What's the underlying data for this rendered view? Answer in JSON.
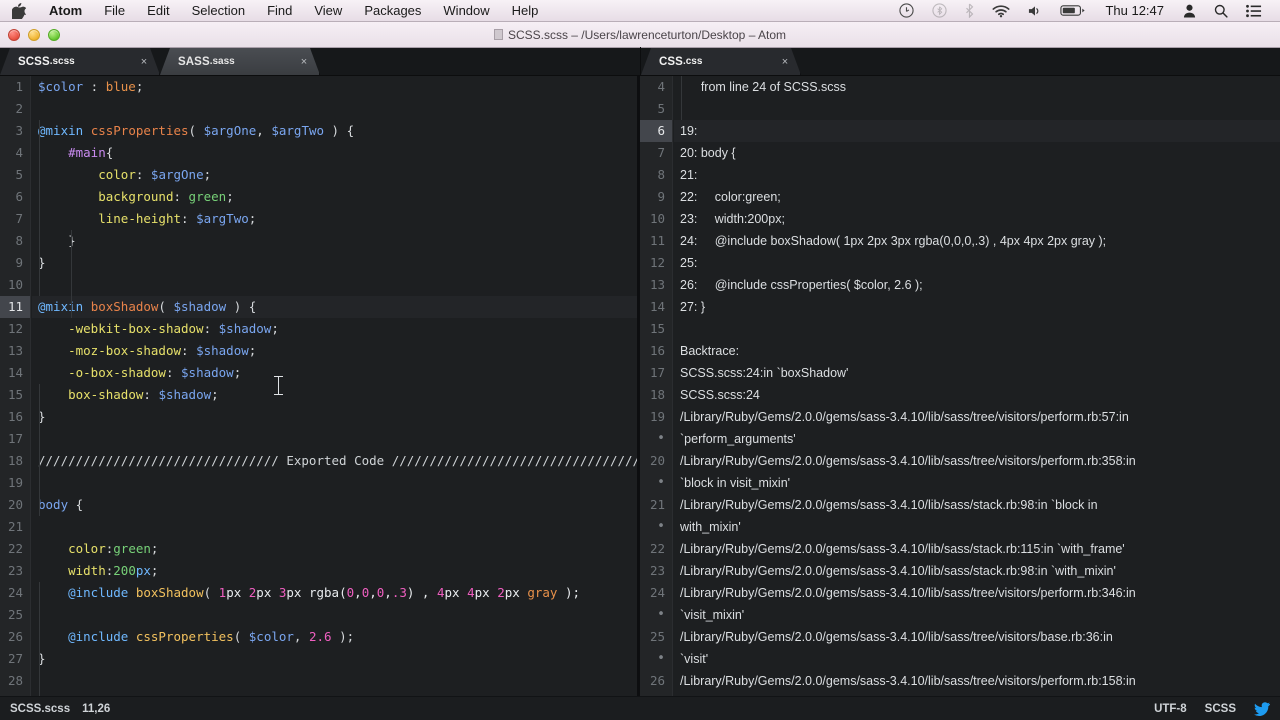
{
  "menubar": {
    "apple_icon": "apple-logo-icon",
    "items": [
      {
        "label": "Atom",
        "bold": true
      },
      {
        "label": "File"
      },
      {
        "label": "Edit"
      },
      {
        "label": "Selection"
      },
      {
        "label": "Find"
      },
      {
        "label": "View"
      },
      {
        "label": "Packages"
      },
      {
        "label": "Window"
      },
      {
        "label": "Help"
      }
    ],
    "status_icons": [
      "airplay-icon",
      "bluetooth-icon",
      "wifi-icon",
      "volume-icon",
      "battery-icon"
    ],
    "clock": "Thu 12:47",
    "right_icons": [
      "user-icon",
      "search-icon",
      "notification-center-icon"
    ]
  },
  "titlebar": {
    "title": "SCSS.scss – /Users/lawrenceturton/Desktop – Atom",
    "traffic_lights": [
      "close",
      "minimize",
      "zoom"
    ]
  },
  "tabs": {
    "left_group": [
      {
        "name": "SCSS",
        "ext": ".scss",
        "active": true,
        "close": "×"
      },
      {
        "name": "SASS",
        "ext": ".sass",
        "active": false,
        "close": "×"
      }
    ],
    "right_group": [
      {
        "name": "CSS",
        "ext": ".css",
        "active": true,
        "close": "×"
      }
    ]
  },
  "left_editor": {
    "file": "SCSS.scss",
    "active_line": 11,
    "first_line": 1,
    "last_visible_line": 28,
    "lines": [
      {
        "n": 1,
        "tokens": [
          {
            "t": "$color",
            "c": "v"
          },
          {
            "t": " : ",
            "c": "pun"
          },
          {
            "t": "blue",
            "c": "orn"
          },
          {
            "t": ";",
            "c": "pun"
          }
        ]
      },
      {
        "n": 2,
        "tokens": []
      },
      {
        "n": 3,
        "tokens": [
          {
            "t": "@mixin",
            "c": "kw"
          },
          {
            "t": " ",
            "c": "pun"
          },
          {
            "t": "cssProperties",
            "c": "fn2"
          },
          {
            "t": "( ",
            "c": "pun"
          },
          {
            "t": "$argOne",
            "c": "v"
          },
          {
            "t": ", ",
            "c": "pun"
          },
          {
            "t": "$argTwo",
            "c": "v"
          },
          {
            "t": " ) {",
            "c": "pun"
          }
        ]
      },
      {
        "n": 4,
        "tokens": [
          {
            "t": "    ",
            "c": "pun"
          },
          {
            "t": "#main",
            "c": "sel"
          },
          {
            "t": "{",
            "c": "pun"
          }
        ]
      },
      {
        "n": 5,
        "tokens": [
          {
            "t": "        ",
            "c": "pun"
          },
          {
            "t": "color",
            "c": "prop"
          },
          {
            "t": ": ",
            "c": "pun"
          },
          {
            "t": "$argOne",
            "c": "v"
          },
          {
            "t": ";",
            "c": "pun"
          }
        ]
      },
      {
        "n": 6,
        "tokens": [
          {
            "t": "        ",
            "c": "pun"
          },
          {
            "t": "background",
            "c": "prop"
          },
          {
            "t": ": ",
            "c": "pun"
          },
          {
            "t": "green",
            "c": "val"
          },
          {
            "t": ";",
            "c": "pun"
          }
        ]
      },
      {
        "n": 7,
        "tokens": [
          {
            "t": "        ",
            "c": "pun"
          },
          {
            "t": "line-height",
            "c": "prop"
          },
          {
            "t": ": ",
            "c": "pun"
          },
          {
            "t": "$argTwo",
            "c": "v"
          },
          {
            "t": ";",
            "c": "pun"
          }
        ]
      },
      {
        "n": 8,
        "tokens": [
          {
            "t": "    }",
            "c": "pun"
          }
        ]
      },
      {
        "n": 9,
        "tokens": [
          {
            "t": "}",
            "c": "pun"
          }
        ]
      },
      {
        "n": 10,
        "tokens": []
      },
      {
        "n": 11,
        "tokens": [
          {
            "t": "@mixin",
            "c": "kw"
          },
          {
            "t": " ",
            "c": "pun"
          },
          {
            "t": "boxShadow",
            "c": "fn2"
          },
          {
            "t": "( ",
            "c": "pun"
          },
          {
            "t": "$shadow",
            "c": "v"
          },
          {
            "t": " ) {",
            "c": "pun"
          }
        ]
      },
      {
        "n": 12,
        "tokens": [
          {
            "t": "    ",
            "c": "pun"
          },
          {
            "t": "-webkit-box-shadow",
            "c": "prop"
          },
          {
            "t": ": ",
            "c": "pun"
          },
          {
            "t": "$shadow",
            "c": "v"
          },
          {
            "t": ";",
            "c": "pun"
          }
        ]
      },
      {
        "n": 13,
        "tokens": [
          {
            "t": "    ",
            "c": "pun"
          },
          {
            "t": "-moz-box-shadow",
            "c": "prop"
          },
          {
            "t": ": ",
            "c": "pun"
          },
          {
            "t": "$shadow",
            "c": "v"
          },
          {
            "t": ";",
            "c": "pun"
          }
        ]
      },
      {
        "n": 14,
        "tokens": [
          {
            "t": "    ",
            "c": "pun"
          },
          {
            "t": "-o-box-shadow",
            "c": "prop"
          },
          {
            "t": ": ",
            "c": "pun"
          },
          {
            "t": "$shadow",
            "c": "v"
          },
          {
            "t": ";",
            "c": "pun"
          }
        ]
      },
      {
        "n": 15,
        "tokens": [
          {
            "t": "    ",
            "c": "pun"
          },
          {
            "t": "box-shadow",
            "c": "prop"
          },
          {
            "t": ": ",
            "c": "pun"
          },
          {
            "t": "$shadow",
            "c": "v"
          },
          {
            "t": ";",
            "c": "pun"
          }
        ]
      },
      {
        "n": 16,
        "tokens": [
          {
            "t": "}",
            "c": "pun"
          }
        ]
      },
      {
        "n": 17,
        "tokens": []
      },
      {
        "n": 18,
        "tokens": [
          {
            "t": "//////////////////////////////// Exported Code //////////////////////////////////////////.",
            "c": "cmt"
          }
        ]
      },
      {
        "n": 19,
        "tokens": []
      },
      {
        "n": 20,
        "tokens": [
          {
            "t": "body",
            "c": "v"
          },
          {
            "t": " {",
            "c": "pun"
          }
        ]
      },
      {
        "n": 21,
        "tokens": []
      },
      {
        "n": 22,
        "tokens": [
          {
            "t": "    ",
            "c": "pun"
          },
          {
            "t": "color",
            "c": "prop"
          },
          {
            "t": ":",
            "c": "pun"
          },
          {
            "t": "green",
            "c": "val"
          },
          {
            "t": ";",
            "c": "pun"
          }
        ]
      },
      {
        "n": 23,
        "tokens": [
          {
            "t": "    ",
            "c": "pun"
          },
          {
            "t": "width",
            "c": "prop"
          },
          {
            "t": ":",
            "c": "pun"
          },
          {
            "t": "200",
            "c": "val"
          },
          {
            "t": "px",
            "c": "kw"
          },
          {
            "t": ";",
            "c": "pun"
          }
        ]
      },
      {
        "n": 24,
        "tokens": [
          {
            "t": "    ",
            "c": "pun"
          },
          {
            "t": "@include",
            "c": "kw"
          },
          {
            "t": " ",
            "c": "pun"
          },
          {
            "t": "boxShadow",
            "c": "fn"
          },
          {
            "t": "( ",
            "c": "pun"
          },
          {
            "t": "1",
            "c": "num"
          },
          {
            "t": "px ",
            "c": "white"
          },
          {
            "t": "2",
            "c": "num"
          },
          {
            "t": "px ",
            "c": "white"
          },
          {
            "t": "3",
            "c": "num"
          },
          {
            "t": "px ",
            "c": "white"
          },
          {
            "t": "rgba(",
            "c": "white"
          },
          {
            "t": "0",
            "c": "num"
          },
          {
            "t": ",",
            "c": "white"
          },
          {
            "t": "0",
            "c": "num"
          },
          {
            "t": ",",
            "c": "white"
          },
          {
            "t": "0",
            "c": "num"
          },
          {
            "t": ",",
            "c": "white"
          },
          {
            "t": ".3",
            "c": "num"
          },
          {
            "t": ") , ",
            "c": "white"
          },
          {
            "t": "4",
            "c": "num"
          },
          {
            "t": "px ",
            "c": "white"
          },
          {
            "t": "4",
            "c": "num"
          },
          {
            "t": "px ",
            "c": "white"
          },
          {
            "t": "2",
            "c": "num"
          },
          {
            "t": "px ",
            "c": "white"
          },
          {
            "t": "gray",
            "c": "orn"
          },
          {
            "t": " );",
            "c": "white"
          }
        ]
      },
      {
        "n": 25,
        "tokens": []
      },
      {
        "n": 26,
        "tokens": [
          {
            "t": "    ",
            "c": "pun"
          },
          {
            "t": "@include",
            "c": "kw"
          },
          {
            "t": " ",
            "c": "pun"
          },
          {
            "t": "cssProperties",
            "c": "fn"
          },
          {
            "t": "( ",
            "c": "pun"
          },
          {
            "t": "$color",
            "c": "v"
          },
          {
            "t": ", ",
            "c": "pun"
          },
          {
            "t": "2.6",
            "c": "num"
          },
          {
            "t": " );",
            "c": "pun"
          }
        ]
      },
      {
        "n": 27,
        "tokens": [
          {
            "t": "}",
            "c": "pun"
          }
        ]
      },
      {
        "n": 28,
        "tokens": []
      }
    ]
  },
  "right_editor": {
    "file": "CSS.css",
    "active_line": 6,
    "lines": [
      {
        "n": "4",
        "text": "      from line 24 of SCSS.scss"
      },
      {
        "n": "5",
        "text": ""
      },
      {
        "n": "6",
        "text": "19:",
        "active": true
      },
      {
        "n": "7",
        "text": "20: body {"
      },
      {
        "n": "8",
        "text": "21:"
      },
      {
        "n": "9",
        "text": "22:     color:green;"
      },
      {
        "n": "10",
        "text": "23:     width:200px;"
      },
      {
        "n": "11",
        "text": "24:     @include boxShadow( 1px 2px 3px rgba(0,0,0,.3) , 4px 4px 2px gray );"
      },
      {
        "n": "12",
        "text": "25:"
      },
      {
        "n": "13",
        "text": "26:     @include cssProperties( $color, 2.6 );"
      },
      {
        "n": "14",
        "text": "27: }"
      },
      {
        "n": "15",
        "text": ""
      },
      {
        "n": "16",
        "text": "Backtrace:"
      },
      {
        "n": "17",
        "text": "SCSS.scss:24:in `boxShadow'"
      },
      {
        "n": "18",
        "text": "SCSS.scss:24"
      },
      {
        "n": "19",
        "text": "/Library/Ruby/Gems/2.0.0/gems/sass-3.4.10/lib/sass/tree/visitors/perform.rb:57:in"
      },
      {
        "n": "•",
        "text": "`perform_arguments'",
        "wrap": true
      },
      {
        "n": "20",
        "text": "/Library/Ruby/Gems/2.0.0/gems/sass-3.4.10/lib/sass/tree/visitors/perform.rb:358:in"
      },
      {
        "n": "•",
        "text": "`block in visit_mixin'",
        "wrap": true
      },
      {
        "n": "21",
        "text": "/Library/Ruby/Gems/2.0.0/gems/sass-3.4.10/lib/sass/stack.rb:98:in `block in"
      },
      {
        "n": "•",
        "text": "with_mixin'",
        "wrap": true
      },
      {
        "n": "22",
        "text": "/Library/Ruby/Gems/2.0.0/gems/sass-3.4.10/lib/sass/stack.rb:115:in `with_frame'"
      },
      {
        "n": "23",
        "text": "/Library/Ruby/Gems/2.0.0/gems/sass-3.4.10/lib/sass/stack.rb:98:in `with_mixin'"
      },
      {
        "n": "24",
        "text": "/Library/Ruby/Gems/2.0.0/gems/sass-3.4.10/lib/sass/tree/visitors/perform.rb:346:in"
      },
      {
        "n": "•",
        "text": "`visit_mixin'",
        "wrap": true
      },
      {
        "n": "25",
        "text": "/Library/Ruby/Gems/2.0.0/gems/sass-3.4.10/lib/sass/tree/visitors/base.rb:36:in"
      },
      {
        "n": "•",
        "text": "`visit'",
        "wrap": true
      },
      {
        "n": "26",
        "text": "/Library/Ruby/Gems/2.0.0/gems/sass-3.4.10/lib/sass/tree/visitors/perform.rb:158:in"
      }
    ]
  },
  "statusbar": {
    "file": "SCSS.scss",
    "cursor": "11,26",
    "encoding": "UTF-8",
    "grammar": "SCSS",
    "bird_icon": "twitter-bird-icon"
  },
  "colors": {
    "editor_bg": "#1d1f21",
    "gutter_bg": "#232527",
    "active_line_gutter": "#43464c",
    "tab_active": "#282a2e",
    "menubar_bg": "#efe7ee",
    "accent_blue": "#6fb8ff",
    "accent_magenta": "#ef5fc0"
  }
}
